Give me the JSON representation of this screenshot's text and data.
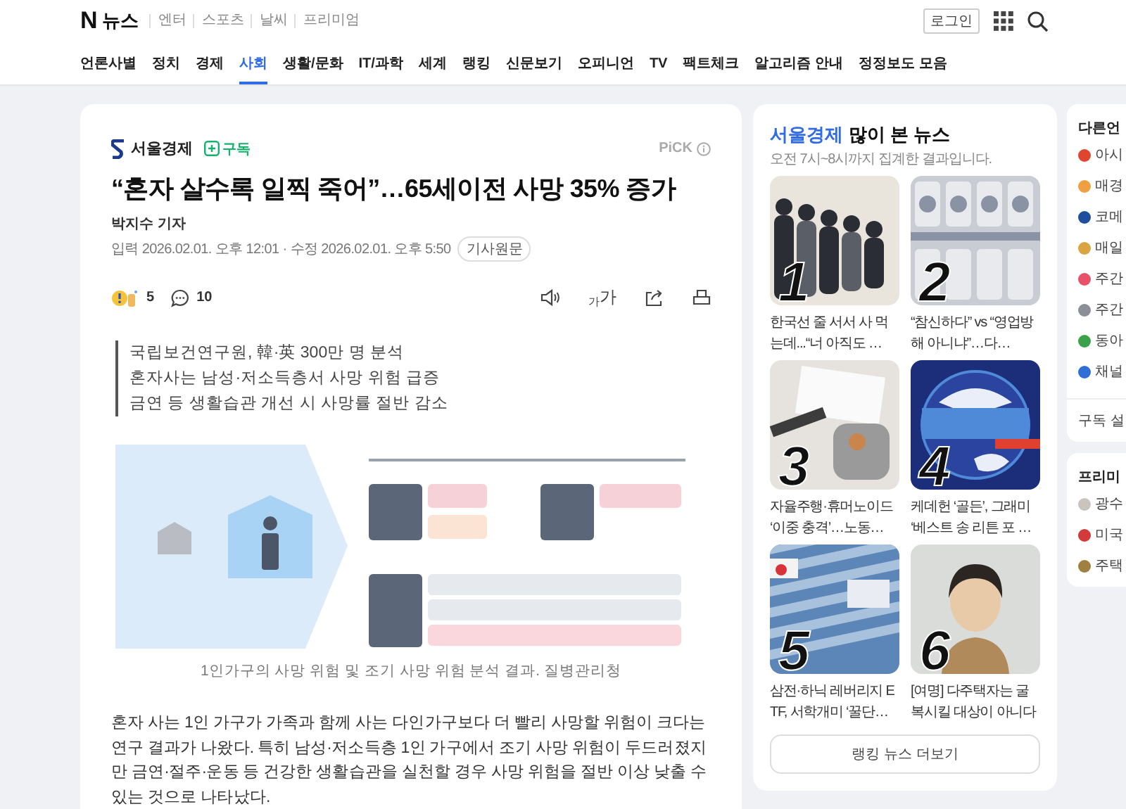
{
  "header": {
    "logo_mark": "N",
    "logo": "뉴스",
    "sections": [
      "엔터",
      "스포츠",
      "날씨",
      "프리미엄"
    ],
    "login": "로그인"
  },
  "nav": [
    {
      "label": "언론사별",
      "selected": false
    },
    {
      "label": "정치",
      "selected": false
    },
    {
      "label": "경제",
      "selected": false
    },
    {
      "label": "사회",
      "selected": true
    },
    {
      "label": "생활/문화",
      "selected": false
    },
    {
      "label": "IT/과학",
      "selected": false
    },
    {
      "label": "세계",
      "selected": false
    },
    {
      "label": "랭킹",
      "selected": false
    },
    {
      "label": "신문보기",
      "selected": false
    },
    {
      "label": "오피니언",
      "selected": false
    },
    {
      "label": "TV",
      "selected": false
    },
    {
      "label": "팩트체크",
      "selected": false
    },
    {
      "label": "알고리즘 안내",
      "selected": false
    },
    {
      "label": "정정보도 모음",
      "selected": false
    }
  ],
  "article": {
    "press": "서울경제",
    "subscribe": "구독",
    "pick": "PiCK",
    "title": "“혼자 살수록 일찍 죽어”…65세이전 사망 35% 증가",
    "reporter": "박지수 기자",
    "dates": "입력 2026.02.01. 오후 12:01 · 수정 2026.02.01. 오후 5:50",
    "original": "기사원문",
    "reactions": "5",
    "comments": "10",
    "font_small": "가",
    "font_large": "가",
    "summary": [
      "국립보건연구원, 韓·英 300만 명 분석",
      "혼자사는 남성·저소득층서 사망 위험 급증",
      "금연 등 생활습관 개선 시 사망률 절반 감소"
    ],
    "caption": "1인가구의 사망 위험 및 조기 사망 위험 분석 결과. 질병관리청",
    "body": "혼자 사는 1인 가구가 가족과 함께 사는 다인가구보다 더 빨리 사망할 위험이 크다는 연구 결과가 나왔다. 특히 남성·저소득층 1인 가구에서 조기 사망 위험이 두드러졌지만 금연·절주·운동 등 건강한 생활습관을 실천할 경우 사망 위험을 절반 이상 낮출 수 있는 것으로 나타났다."
  },
  "ranking": {
    "press": "서울경제",
    "title": "많이 본 뉴스",
    "subtitle": "오전 7시~8시까지 집계한 결과입니다.",
    "items": [
      {
        "rank": "1",
        "title": "한국선 줄 서서 사 먹는데...“너 아직도 …"
      },
      {
        "rank": "2",
        "title": "“참신하다” vs “영업방해 아니냐”…다…"
      },
      {
        "rank": "3",
        "title": "자율주행·휴머노이드 ‘이중 충격’…노동…"
      },
      {
        "rank": "4",
        "title": "케데헌 ‘골든’, 그래미 ‘베스트 송 리튼 포 …"
      },
      {
        "rank": "5",
        "title": "삼전·하닉 레버리지 ETF, 서학개미 ‘꿀단…"
      },
      {
        "rank": "6",
        "title": "[여명] 다주택자는 굴복시킬 대상이 아니다"
      }
    ],
    "more": "랭킹 뉴스 더보기"
  },
  "other_press": {
    "title": "다른언",
    "items": [
      {
        "name": "아시",
        "color": "#e0452f"
      },
      {
        "name": "매경",
        "color": "#f0a040"
      },
      {
        "name": "코메",
        "color": "#1f4e9c"
      },
      {
        "name": "매일",
        "color": "#d9a441"
      },
      {
        "name": "주간",
        "color": "#e8506a"
      },
      {
        "name": "주간",
        "color": "#8a8f98"
      },
      {
        "name": "동아",
        "color": "#3aa34a"
      },
      {
        "name": "채널",
        "color": "#2f6fd6"
      }
    ],
    "settings": "구독 설"
  },
  "premium": {
    "title": "프리미",
    "items": [
      {
        "name": "광수",
        "color": "#c9c4bc"
      },
      {
        "name": "미국",
        "color": "#d33a3a"
      },
      {
        "name": "주택",
        "color": "#a08040"
      }
    ]
  }
}
